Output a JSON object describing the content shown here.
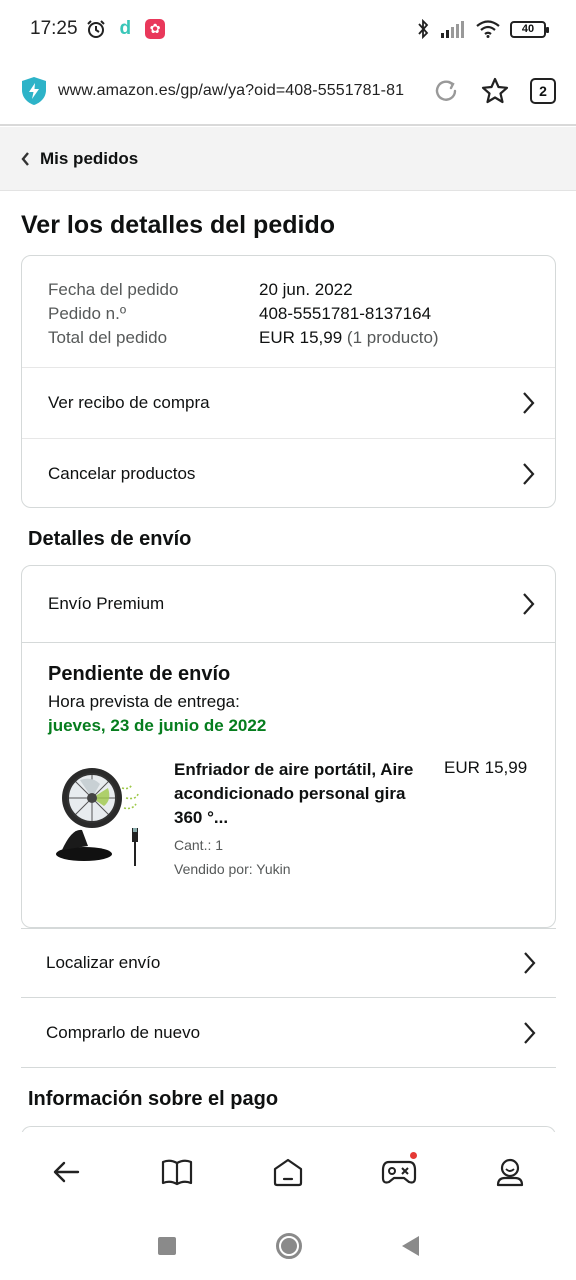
{
  "status_bar": {
    "time": "17:25",
    "app_d": "d",
    "battery": "40"
  },
  "url_bar": {
    "url": "www.amazon.es/gp/aw/ya?oid=408-5551781-81",
    "tab_count": "2"
  },
  "breadcrumb": {
    "label": "Mis pedidos"
  },
  "page": {
    "title": "Ver los detalles del pedido"
  },
  "order_summary": {
    "date_label": "Fecha del pedido",
    "date_value": "20 jun. 2022",
    "number_label": "Pedido n.º",
    "number_value": "408-5551781-8137164",
    "total_label": "Total del pedido",
    "total_value": "EUR 15,99",
    "total_count": "(1 producto)",
    "receipt_link": "Ver recibo de compra",
    "cancel_link": "Cancelar productos"
  },
  "shipping": {
    "section_title": "Detalles de envío",
    "method": "Envío Premium",
    "status": "Pendiente de envío",
    "eta_label": "Hora prevista de entrega:",
    "eta_date": "jueves, 23 de junio de 2022",
    "item": {
      "title": "Enfriador de aire portátil, Aire acondicionado personal gira 360 °...",
      "quantity": "Cant.: 1",
      "seller": "Vendido por: Yukin",
      "price": "EUR 15,99"
    }
  },
  "actions": {
    "track": "Localizar envío",
    "buy_again": "Comprarlo de nuevo"
  },
  "payment": {
    "section_title": "Información sobre el pago"
  },
  "colors": {
    "delivery_green": "#067d1e",
    "shield_teal": "#2db3c8",
    "notification_red": "#e53935"
  },
  "icons": {
    "status": [
      "alarm-icon",
      "bluetooth-icon",
      "signal-icon",
      "wifi-icon",
      "battery-icon"
    ],
    "url_bar": [
      "shield-icon",
      "reload-icon",
      "star-icon",
      "tabs-icon"
    ],
    "bottom_nav": [
      "back-arrow-icon",
      "book-icon",
      "home-icon",
      "game-icon",
      "profile-icon"
    ]
  }
}
